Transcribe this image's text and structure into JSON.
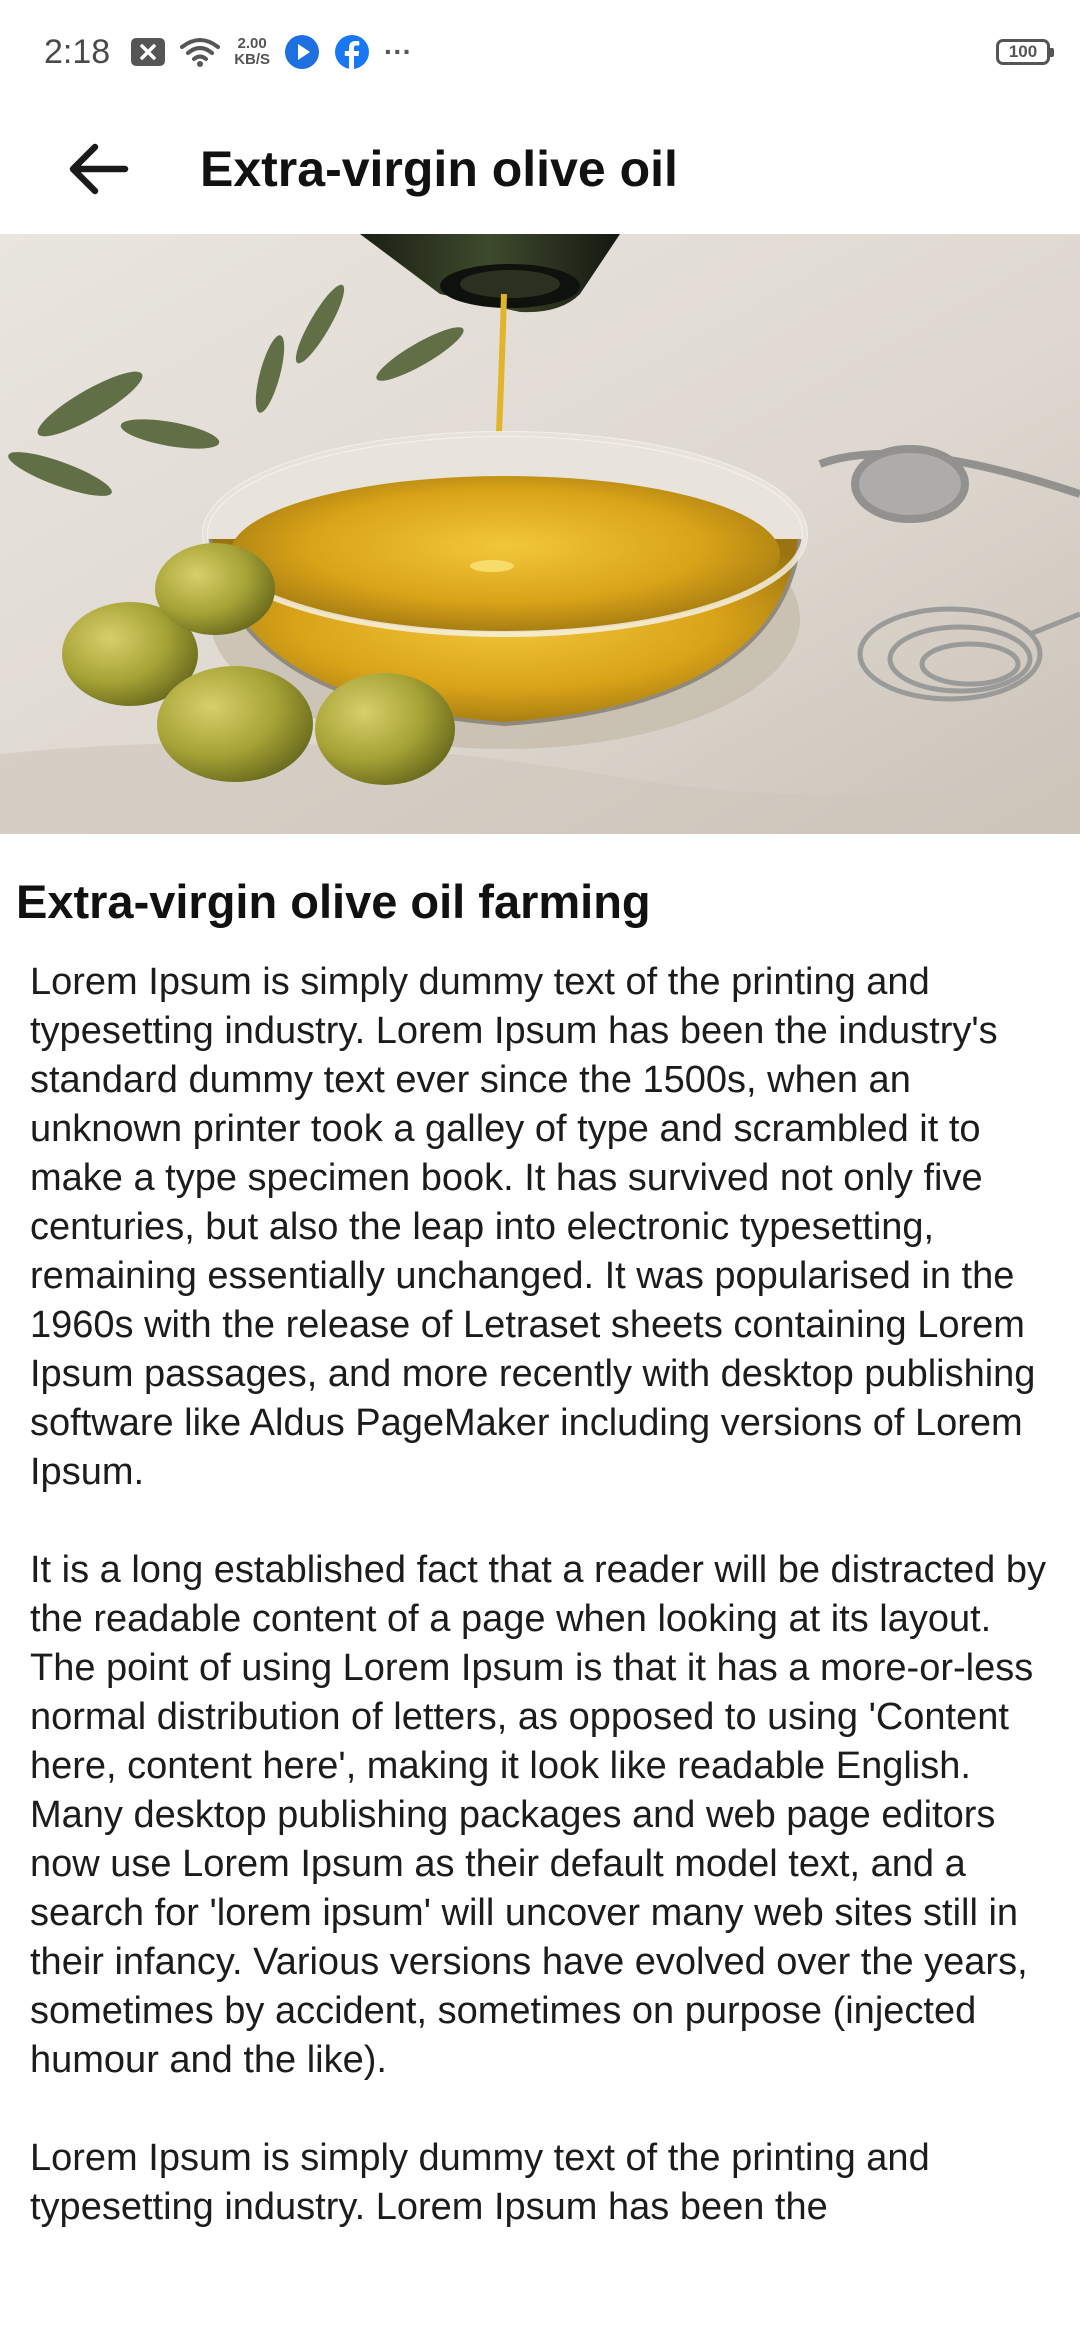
{
  "status_bar": {
    "time": "2:18",
    "net_speed_value": "2.00",
    "net_speed_unit": "KB/S",
    "more": "···",
    "battery": "100"
  },
  "app_bar": {
    "title": "Extra-virgin olive oil",
    "back_icon": "arrow-left-icon"
  },
  "hero_image": {
    "subject": "olive-oil-bowl-photo"
  },
  "article": {
    "title": "Extra-virgin olive oil farming",
    "paragraphs": [
      "Lorem Ipsum is simply dummy text of the printing and typesetting industry. Lorem Ipsum has been the industry's standard dummy text ever since the 1500s, when an unknown printer took a galley of type and scrambled it to make a type specimen book. It has survived not only five centuries, but also the leap into electronic typesetting, remaining essentially unchanged. It was popularised in the 1960s with the release of Letraset sheets containing Lorem Ipsum passages, and more recently with desktop publishing software like Aldus PageMaker including versions of Lorem Ipsum.",
      "It is a long established fact that a reader will be distracted by the readable content of a page when looking at its layout. The point of using Lorem Ipsum is that it has a more-or-less normal distribution of letters, as opposed to using 'Content here, content here', making it look like readable English. Many desktop publishing packages and web page editors now use Lorem Ipsum as their default model text, and a search for 'lorem ipsum' will uncover many web sites still in their infancy. Various versions have evolved over the years, sometimes by accident, sometimes on purpose (injected humour and the like).",
      "Lorem Ipsum is simply dummy text of the printing and typesetting industry. Lorem Ipsum has been the"
    ]
  }
}
